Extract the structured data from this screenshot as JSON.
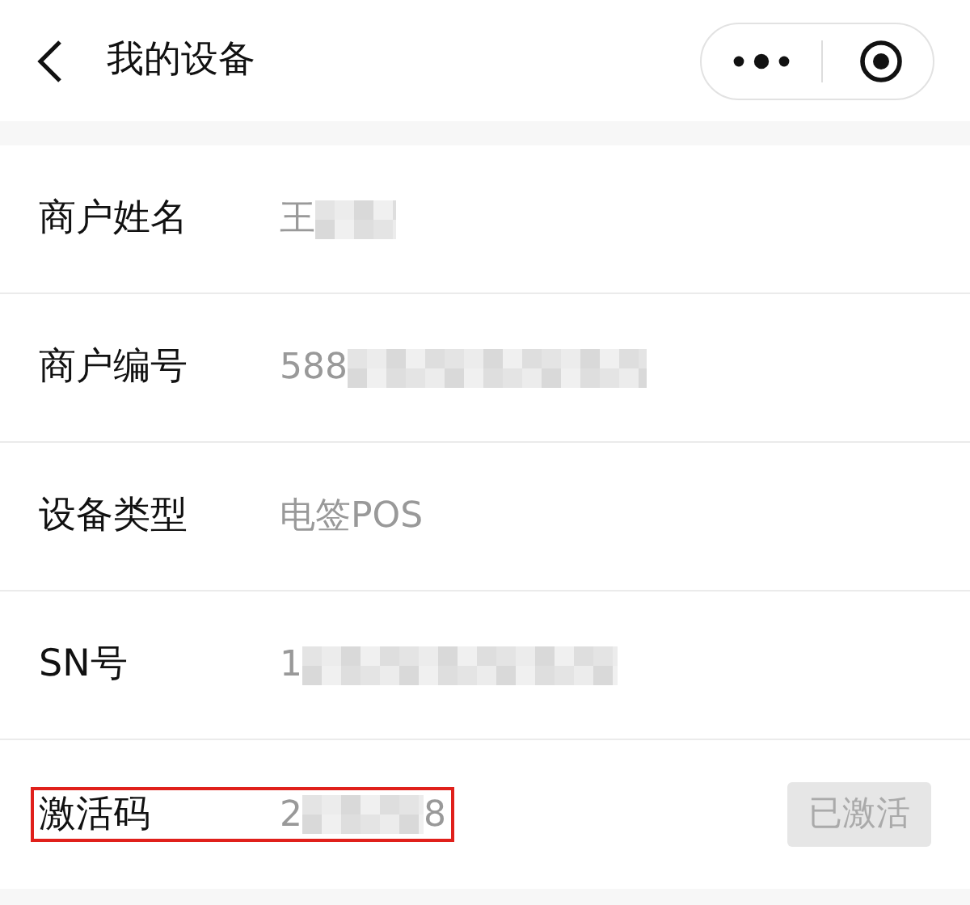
{
  "header": {
    "title": "我的设备"
  },
  "rows": [
    {
      "label": "商户姓名",
      "value": "王",
      "redacted": true,
      "highlighted": false
    },
    {
      "label": "商户编号",
      "value": "588",
      "redacted": true,
      "highlighted": false
    },
    {
      "label": "设备类型",
      "value": "电签POS",
      "redacted": false,
      "highlighted": false
    },
    {
      "label": "SN号",
      "value": "1",
      "redacted": true,
      "highlighted": false
    },
    {
      "label": "激活码",
      "value": "2",
      "redacted": true,
      "value_end": "8",
      "highlighted": true,
      "button": {
        "label": "已激活",
        "disabled": true
      }
    }
  ]
}
